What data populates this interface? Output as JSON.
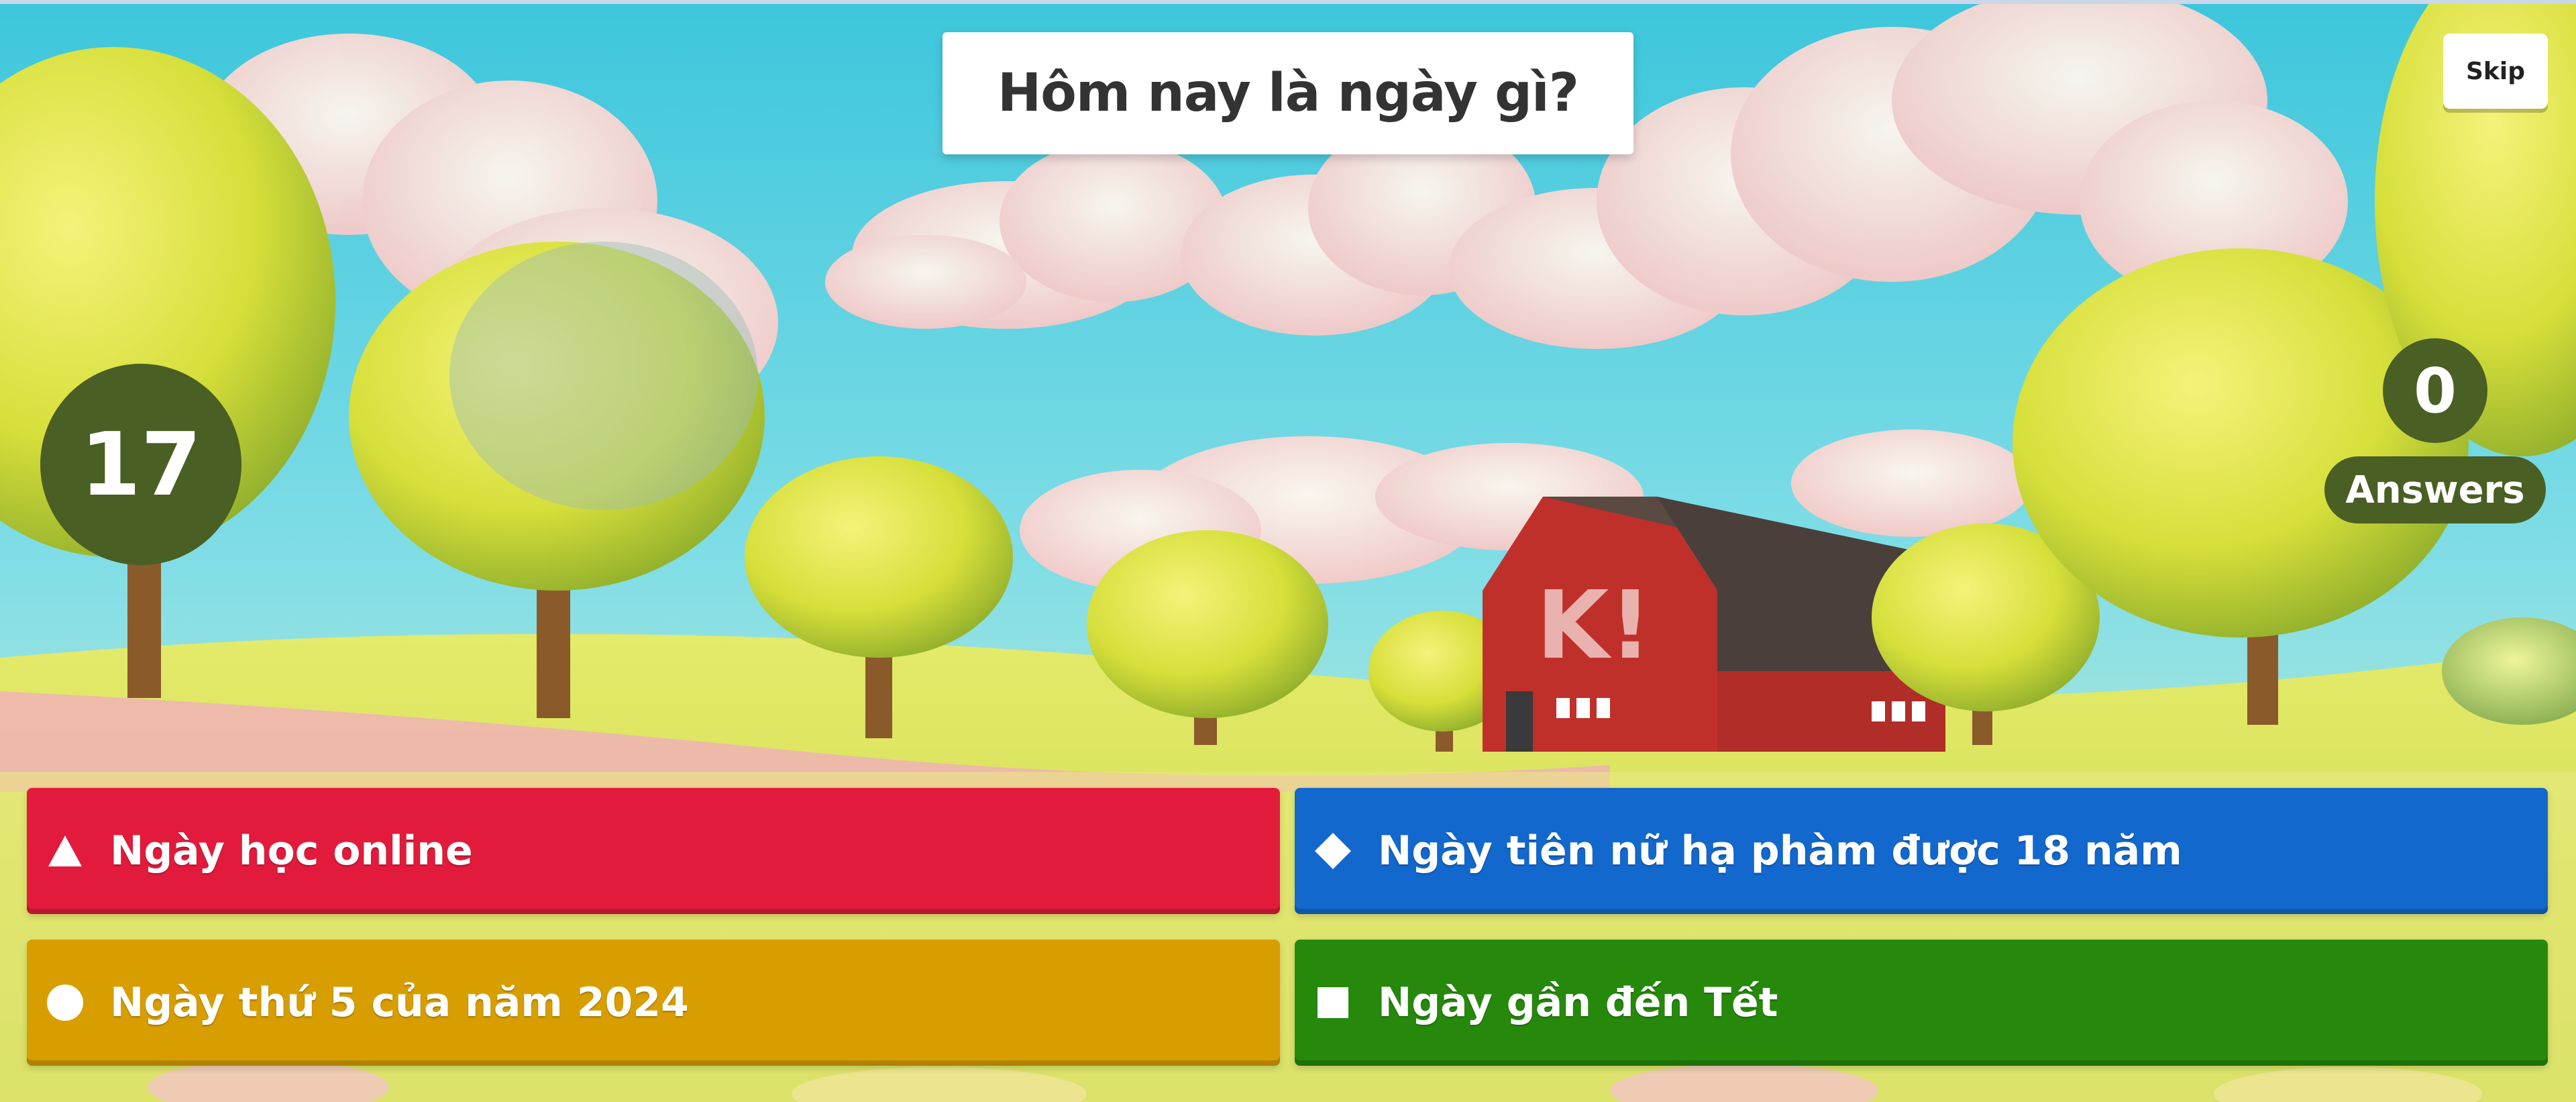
{
  "question": {
    "text": "Hôm nay là ngày gì?"
  },
  "controls": {
    "skip_label": "Skip"
  },
  "timer": {
    "seconds": "17"
  },
  "answers_counter": {
    "count": "0",
    "label": "Answers"
  },
  "answers": [
    {
      "shape": "triangle-icon",
      "label": "Ngày học online",
      "color": "#e21b3c"
    },
    {
      "shape": "diamond-icon",
      "label": "Ngày tiên nữ hạ phàm được 18 năm",
      "color": "#1368ce"
    },
    {
      "shape": "circle-icon",
      "label": "Ngày thứ 5 của năm 2024",
      "color": "#d89e00"
    },
    {
      "shape": "square-icon",
      "label": "Ngày gần đến Tết",
      "color": "#26890c"
    }
  ],
  "background": {
    "barn_text": "K!"
  }
}
